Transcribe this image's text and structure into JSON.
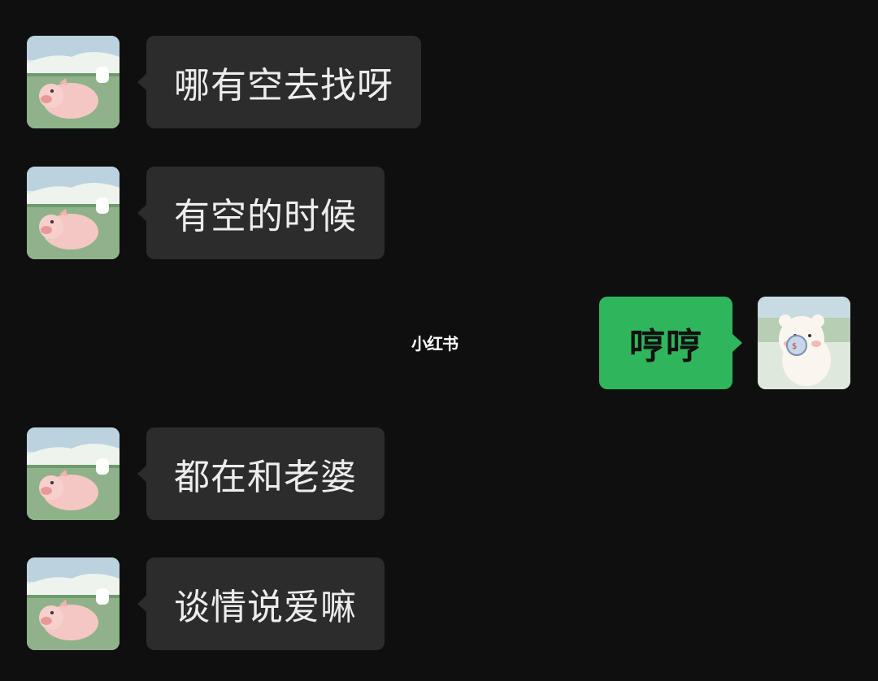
{
  "messages": [
    {
      "side": "left",
      "text": "哪有空去找呀"
    },
    {
      "side": "left",
      "text": "有空的时候"
    },
    {
      "side": "right",
      "text": "哼哼"
    },
    {
      "side": "left",
      "text": "都在和老婆"
    },
    {
      "side": "left",
      "text": "谈情说爱嘛"
    }
  ],
  "watermark": "小红书",
  "colors": {
    "background": "#0f0f0f",
    "incoming_bubble": "#2c2c2c",
    "outgoing_bubble": "#2fb65c"
  },
  "avatars": {
    "incoming": "pig-avatar-icon",
    "outgoing": "bear-avatar-icon"
  }
}
